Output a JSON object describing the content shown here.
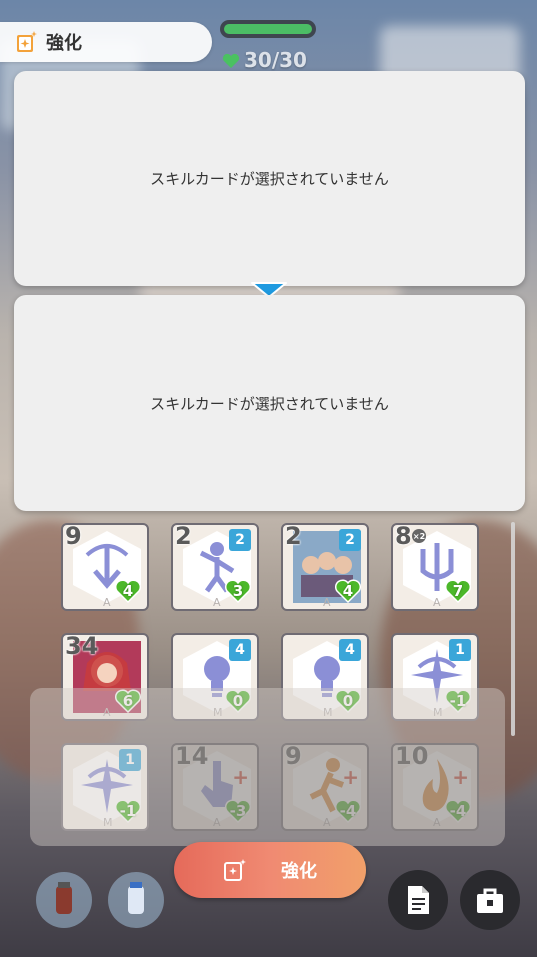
{
  "header": {
    "title": "強化",
    "stamina_text": "30/30",
    "stamina_fraction": 1.0
  },
  "panels": {
    "top_message": "スキルカードが選択されていません",
    "bottom_message": "スキルカードが選択されていません"
  },
  "cards": [
    {
      "cost": "9",
      "level": "",
      "heart": "4",
      "rarity": "A",
      "icon": "arrows-down-icon",
      "dim": false
    },
    {
      "cost": "2",
      "level": "2",
      "heart": "3",
      "rarity": "A",
      "icon": "figure-jump-icon",
      "dim": false
    },
    {
      "cost": "2",
      "level": "2",
      "heart": "4",
      "rarity": "A",
      "icon": "photo-group-icon",
      "dim": false
    },
    {
      "cost": "8",
      "level": "",
      "heart": "7",
      "rarity": "A",
      "icon": "trident-icon",
      "dim": false,
      "multiplier": "×2"
    },
    {
      "cost": "34",
      "level": "",
      "heart": "6",
      "rarity": "A",
      "icon": "idol-portrait-icon",
      "dim": false
    },
    {
      "cost": "",
      "level": "4",
      "heart": "0",
      "rarity": "M",
      "icon": "lightbulb-icon",
      "dim": false
    },
    {
      "cost": "",
      "level": "4",
      "heart": "0",
      "rarity": "M",
      "icon": "lightbulb-icon",
      "dim": false
    },
    {
      "cost": "",
      "level": "1",
      "heart": "-1",
      "rarity": "M",
      "icon": "sparkle-star-icon",
      "dim": false
    },
    {
      "cost": "",
      "level": "1",
      "heart": "-1",
      "rarity": "M",
      "icon": "sparkle-star-icon",
      "dim": false
    },
    {
      "cost": "14",
      "level": "",
      "heart": "-3",
      "rarity": "A",
      "icon": "hand-point-icon",
      "dim": true
    },
    {
      "cost": "9",
      "level": "",
      "heart": "-4",
      "rarity": "A",
      "icon": "runner-icon",
      "dim": true
    },
    {
      "cost": "10",
      "level": "",
      "heart": "-4",
      "rarity": "A",
      "icon": "flame-icon",
      "dim": true
    }
  ],
  "bottom": {
    "enhance_label": "強化"
  },
  "colors": {
    "panel_bg": "#efefef",
    "accent_blue": "#3aa6d9",
    "heart_green": "#4cb82a",
    "button_gradient_start": "#e56a5a",
    "button_gradient_end": "#f1a06a"
  }
}
